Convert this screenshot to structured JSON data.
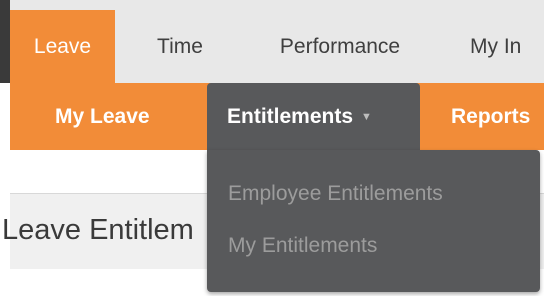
{
  "main_tabs": [
    "Leave",
    "Time",
    "Performance",
    "My In"
  ],
  "sub_nav": {
    "items": [
      "My Leave",
      "Entitlements",
      "Reports"
    ],
    "dropdown_caret": "▼"
  },
  "dropdown": {
    "items": [
      "Employee Entitlements",
      "My Entitlements"
    ]
  },
  "page": {
    "title": "Leave Entitlem"
  },
  "colors": {
    "accent": "#f28c38",
    "dropdown_bg": "#58595b",
    "topbar_bg": "#e8e8e8"
  }
}
